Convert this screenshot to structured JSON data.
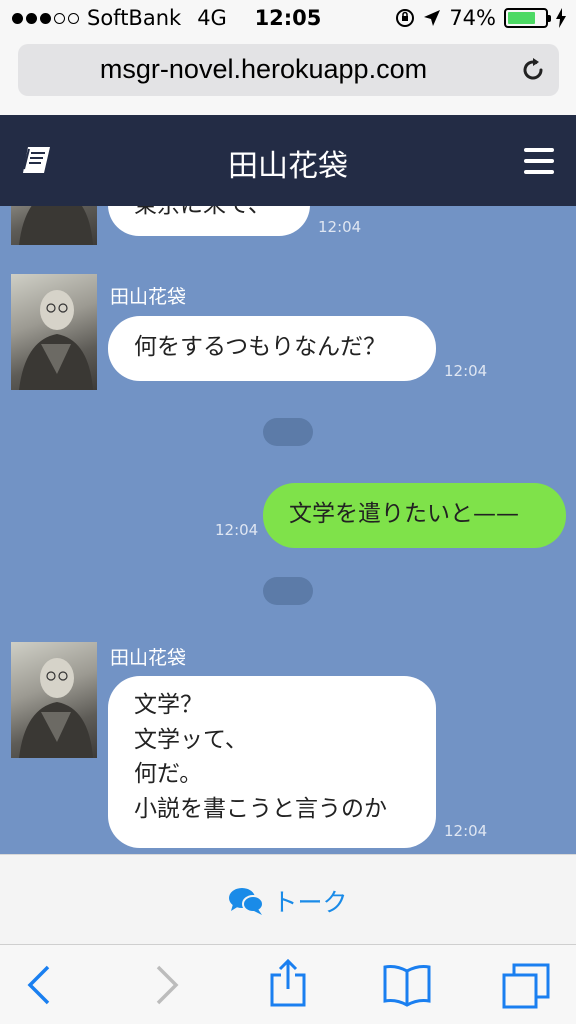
{
  "status_bar": {
    "carrier": "SoftBank",
    "network": "4G",
    "time": "12:05",
    "battery": "74%",
    "battery_level": 0.74
  },
  "browser": {
    "url": "msgr-novel.herokuapp.com"
  },
  "app": {
    "title": "田山花袋"
  },
  "messages": [
    {
      "sender": "",
      "text": "東京に来て、",
      "time": "12:04",
      "side": "left"
    },
    {
      "sender": "田山花袋",
      "text": "何をするつもりなんだ？",
      "time": "12:04",
      "side": "left"
    },
    {
      "sender": "",
      "text": "文学を遣りたいと——",
      "time": "12:04",
      "side": "right"
    },
    {
      "sender": "田山花袋",
      "lines": [
        "文学？",
        "文学ッて、",
        "何だ。",
        "小説を書こうと言うのか"
      ],
      "time": "12:04",
      "side": "left"
    }
  ],
  "tabbar": {
    "tab_label": "トーク"
  },
  "colors": {
    "header": "#232c45",
    "chat_bg": "#7293c5",
    "my_bubble": "#7fe24a",
    "accent": "#1a8be8"
  }
}
